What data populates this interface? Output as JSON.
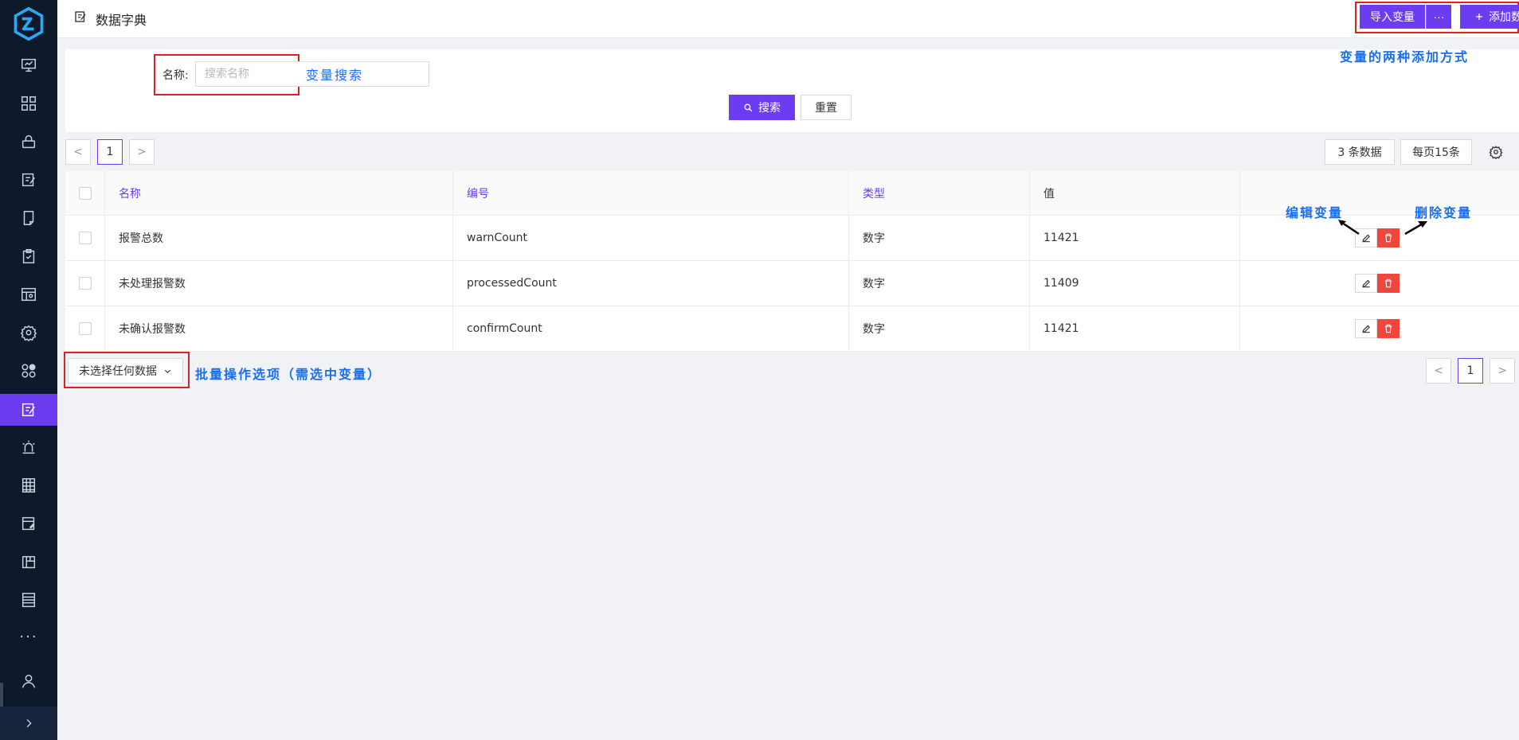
{
  "app": {
    "page_title": "数据字典",
    "accent_color": "#6c3cf0",
    "sidebar_bg": "#0e1a2b"
  },
  "sidebar": {
    "items": [
      {
        "name": "dashboard-monitor-icon"
      },
      {
        "name": "apps-grid-icon"
      },
      {
        "name": "lock-icon"
      },
      {
        "name": "edit-document-icon"
      },
      {
        "name": "notebook-icon"
      },
      {
        "name": "clipboard-check-icon"
      },
      {
        "name": "image-search-icon"
      },
      {
        "name": "settings-gear-icon"
      },
      {
        "name": "modules-icon"
      },
      {
        "name": "data-dictionary-icon",
        "active": true
      },
      {
        "name": "alarm-siren-icon"
      },
      {
        "name": "building-grid-icon"
      },
      {
        "name": "form-edit-icon"
      },
      {
        "name": "map-icon"
      },
      {
        "name": "list-table-icon"
      },
      {
        "name": "more-dots-icon"
      }
    ],
    "more_label": "···"
  },
  "header": {
    "import_label": "导入变量",
    "more_label": "···",
    "add_label": "添加数据字典"
  },
  "annotations": {
    "add_methods": "变量的两种添加方式",
    "search": "变量搜索",
    "edit": "编辑变量",
    "delete": "删除变量",
    "bulk": "批量操作选项（需选中变量）"
  },
  "search": {
    "label": "名称:",
    "placeholder": "搜索名称",
    "search_label": "搜索",
    "reset_label": "重置"
  },
  "pager": {
    "prev": "<",
    "current": "1",
    "next": ">",
    "total": "3 条数据",
    "page_size": "每页15条"
  },
  "table": {
    "columns": [
      "名称",
      "编号",
      "类型",
      "值"
    ],
    "rows": [
      {
        "name": "报警总数",
        "code": "warnCount",
        "type": "数字",
        "value": "11421"
      },
      {
        "name": "未处理报警数",
        "code": "processedCount",
        "type": "数字",
        "value": "11409"
      },
      {
        "name": "未确认报警数",
        "code": "confirmCount",
        "type": "数字",
        "value": "11421"
      }
    ]
  },
  "bulk": {
    "label": "未选择任何数据"
  }
}
